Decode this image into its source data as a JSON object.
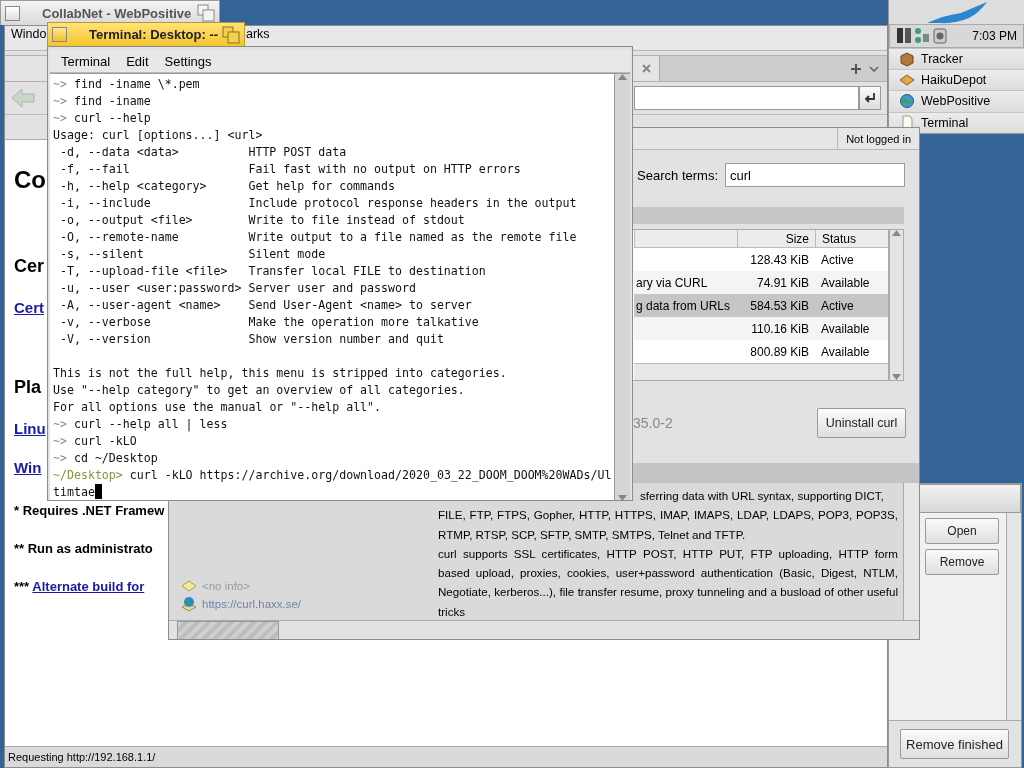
{
  "webpositive": {
    "title": "CollabNet - WebPositive",
    "menu": [
      "Windo",
      "arks"
    ],
    "page": [
      {
        "kind": "h1",
        "text": "Co"
      },
      {
        "kind": "h2",
        "text": "Cer"
      },
      {
        "kind": "link",
        "text": "Cert"
      },
      {
        "kind": "h2",
        "text": "Pla"
      },
      {
        "kind": "link",
        "text": "Linu"
      },
      {
        "kind": "link",
        "text": "Win"
      },
      {
        "kind": "note",
        "text": "* Requires .NET Framew"
      },
      {
        "kind": "note",
        "text": "** Run as administrato"
      },
      {
        "kind": "note",
        "text": "***",
        "link": "Alternate build for"
      }
    ],
    "status": "Requesting http://192.168.1.1/"
  },
  "deskbar": {
    "clock": "7:03 PM",
    "apps": [
      "Tracker",
      "HaikuDepot",
      "WebPositive",
      "Terminal"
    ]
  },
  "haikudepot": {
    "account": "Not logged in",
    "search_label": "Search terms:",
    "search_value": "curl",
    "columns": [
      "Size",
      "Status"
    ],
    "packages": [
      {
        "size": "128.43 KiB",
        "status": "Active",
        "selected": false
      },
      {
        "column_1": "ary via CURL",
        "size": "74.91 KiB",
        "status": "Available",
        "selected": false
      },
      {
        "column_1": "g data from URLs",
        "size": "584.53 KiB",
        "status": "Active",
        "selected": true
      },
      {
        "size": "110.16 KiB",
        "status": "Available",
        "selected": false
      },
      {
        "size": "800.89 KiB",
        "status": "Available",
        "selected": false
      }
    ],
    "version": "35.0-2",
    "uninstall_button": "Uninstall curl",
    "info": [
      {
        "kind": "disabled",
        "text": "<no info>"
      },
      {
        "kind": "link",
        "text": "https://curl.haxx.se/"
      }
    ],
    "description": [
      "sferring data with URL syntax, supporting DICT,",
      "FILE, FTP, FTPS, Gopher, HTTP, HTTPS, IMAP, IMAPS, LDAP, LDAPS, POP3, POP3S, RTMP, RTSP, SCP, SFTP, SMTP, SMTPS, Telnet and TFTP.",
      "curl supports SSL certificates, HTTP POST, HTTP PUT, FTP uploading, HTTP form based upload, proxies, cookies, user+password authentication (Basic, Digest, NTLM, Negotiate, kerberos...), file transfer resume, proxy tunneling and a busload of other useful tricks"
    ]
  },
  "downloads": {
    "buttons": [
      "Open",
      "Remove"
    ],
    "remove_finished": "Remove finished"
  },
  "terminal": {
    "title": "Terminal: Desktop: --",
    "menu": [
      "Terminal",
      "Edit",
      "Settings"
    ],
    "lines": [
      {
        "kind": "prompt",
        "prompt": "~>",
        "color": "#8a8a8a",
        "command": "find -iname \\*.pem"
      },
      {
        "kind": "prompt",
        "prompt": "~>",
        "color": "#8a8a8a",
        "command": "find -iname"
      },
      {
        "kind": "prompt",
        "prompt": "~>",
        "color": "#8a8a8a",
        "command": "curl --help"
      },
      {
        "kind": "output",
        "text": "Usage: curl [options...] <url>"
      },
      {
        "kind": "option",
        "option": "-d, --data <data>",
        "description": "HTTP POST data"
      },
      {
        "kind": "option",
        "option": "-f, --fail",
        "description": "Fail fast with no output on HTTP errors"
      },
      {
        "kind": "option",
        "option": "-h, --help <category>",
        "description": "Get help for commands"
      },
      {
        "kind": "option",
        "option": "-i, --include",
        "description": "Include protocol response headers in the output"
      },
      {
        "kind": "option",
        "option": "-o, --output <file>",
        "description": "Write to file instead of stdout"
      },
      {
        "kind": "option",
        "option": "-O, --remote-name",
        "description": "Write output to a file named as the remote file"
      },
      {
        "kind": "option",
        "option": "-s, --silent",
        "description": "Silent mode"
      },
      {
        "kind": "option",
        "option": "-T, --upload-file <file>",
        "description": "Transfer local FILE to destination"
      },
      {
        "kind": "option",
        "option": "-u, --user <user:password>",
        "description": "Server user and password"
      },
      {
        "kind": "option",
        "option": "-A, --user-agent <name>",
        "description": "Send User-Agent <name> to server"
      },
      {
        "kind": "option",
        "option": "-v, --verbose",
        "description": "Make the operation more talkative"
      },
      {
        "kind": "option",
        "option": "-V, --version",
        "description": "Show version number and quit"
      },
      {
        "kind": "blank"
      },
      {
        "kind": "output",
        "text": "This is not the full help, this menu is stripped into categories."
      },
      {
        "kind": "output",
        "text": "Use \"--help category\" to get an overview of all categories."
      },
      {
        "kind": "output",
        "text": "For all options use the manual or \"--help all\"."
      },
      {
        "kind": "prompt",
        "prompt": "~>",
        "color": "#8a8a8a",
        "command": "curl --help all | less"
      },
      {
        "kind": "prompt",
        "prompt": "~>",
        "color": "#8a8a8a",
        "command": "curl -kLO"
      },
      {
        "kind": "prompt",
        "prompt": "~>",
        "color": "#8a8a8a",
        "command": "cd ~/Desktop"
      },
      {
        "kind": "prompt",
        "prompt": "~/Desktop>",
        "color": "#7f9a3c",
        "command": "curl -kLO https://archive.org/download/2020_03_22_DOOM_DOOM%20WADs/Ul"
      },
      {
        "kind": "output",
        "text": "timtae",
        "cursor": true
      }
    ]
  }
}
